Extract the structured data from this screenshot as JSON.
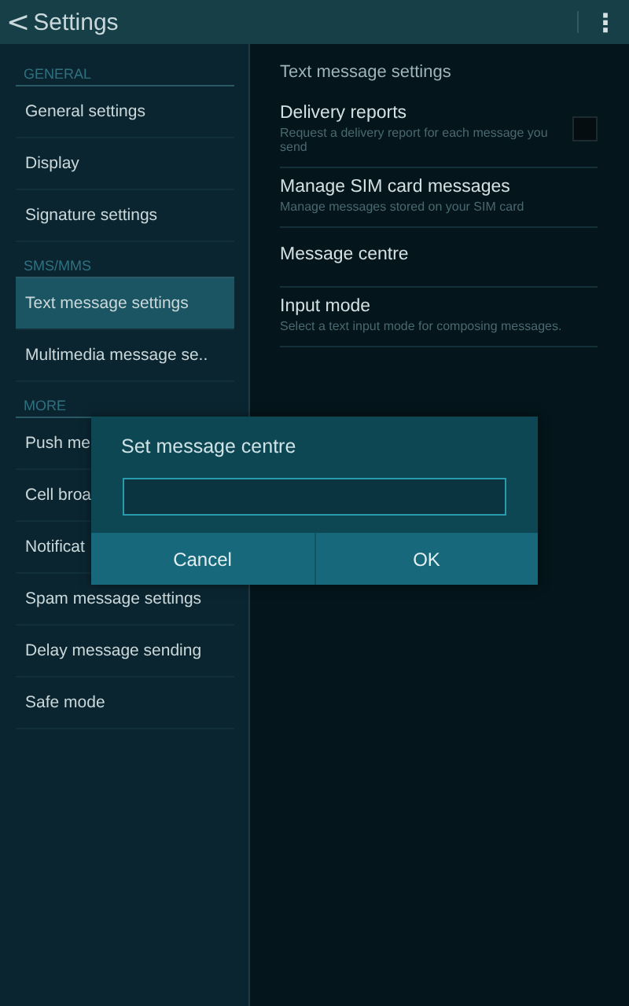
{
  "app_bar": {
    "back": "<",
    "title": "Settings",
    "menu": "⋮"
  },
  "sidebar": {
    "sections": [
      {
        "header": "GENERAL",
        "items": [
          {
            "label": "General settings",
            "selected": false
          },
          {
            "label": "Display",
            "selected": false
          },
          {
            "label": "Signature settings",
            "selected": false
          }
        ]
      },
      {
        "header": "SMS/MMS",
        "items": [
          {
            "label": "Text message settings",
            "selected": true
          },
          {
            "label": "Multimedia message se..",
            "selected": false
          }
        ]
      },
      {
        "header": "MORE",
        "items": [
          {
            "label": "Push me",
            "selected": false
          },
          {
            "label": "Cell broa",
            "selected": false
          },
          {
            "label": "Notificat",
            "selected": false
          },
          {
            "label": "Spam message settings",
            "selected": false
          },
          {
            "label": "Delay message sending",
            "selected": false
          },
          {
            "label": "Safe mode",
            "selected": false
          }
        ]
      }
    ]
  },
  "detail": {
    "header": "Text message settings",
    "items": [
      {
        "kind": "checkbox",
        "title": "Delivery reports",
        "subtitle": "Request a delivery report for each message you send",
        "checked": false
      },
      {
        "kind": "plain",
        "title": "Manage SIM card messages",
        "subtitle": "Manage messages stored on your SIM card"
      },
      {
        "kind": "plain",
        "title": "Message centre"
      },
      {
        "kind": "plain",
        "title": "Input mode",
        "subtitle": "Select a text input mode for composing messages."
      }
    ]
  },
  "dialog": {
    "title": "Set message centre",
    "buttons": [
      "Cancel",
      "OK"
    ]
  }
}
